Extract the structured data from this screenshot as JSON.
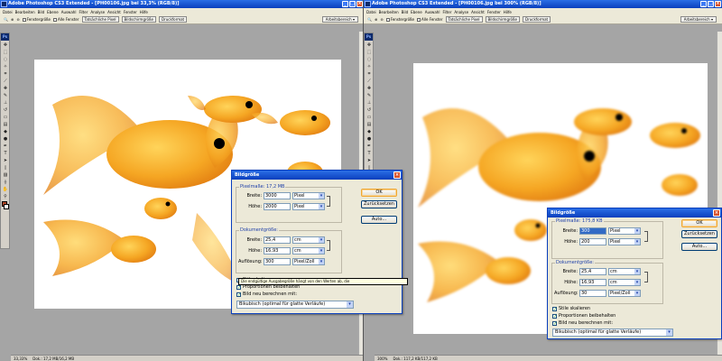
{
  "left": {
    "title": "Adobe Photoshop CS3 Extended - [PH00106.jpg bei 33,3% (RGB/8)]",
    "status_zoom": "33,33%",
    "status_doc": "Dok.: 17,2 MB/16,2 MB"
  },
  "right": {
    "title": "Adobe Photoshop CS3 Extended - [PH00106.jpg bei 300% (RGB/8)]",
    "status_zoom": "300%",
    "status_doc": "Dok.: 117,2 KB/117,2 KB"
  },
  "menu": [
    "Datei",
    "Bearbeiten",
    "Bild",
    "Ebene",
    "Auswahl",
    "Filter",
    "Analyse",
    "Ansicht",
    "Fenster",
    "Hilfe"
  ],
  "options": {
    "resize_windows": "Fenstergröße",
    "all_windows": "Alle Fenster",
    "actual_pixels": "Tatsächliche Pixel",
    "fit_screen": "Bildschirmgröße",
    "print_size": "Druckformat",
    "workspace": "Arbeitsbereich ▾"
  },
  "dialog": {
    "title": "Bildgröße",
    "ok": "OK",
    "reset": "Zurücksetzen",
    "auto": "Auto...",
    "doc_group": "Dokumentgröße:",
    "width_label": "Breite:",
    "height_label": "Höhe:",
    "resolution_label": "Auflösung:",
    "pixel_unit": "Pixel",
    "cm_unit": "cm",
    "res_unit": "Pixel/Zoll",
    "scale_styles": "Stile skalieren",
    "constrain": "Proportionen beibehalten",
    "resample": "Bild neu berechnen mit:",
    "method": "Bikubisch (optimal für glatte Verläufe)"
  },
  "dialogL": {
    "pixel_dims": "Pixelmaße: 17,2 MB",
    "px_width": "3000",
    "px_height": "2000",
    "doc_width": "25,4",
    "doc_height": "16,93",
    "resolution": "300"
  },
  "dialogR": {
    "pixel_dims": "Pixelmaße: 175,8 KB",
    "px_width": "300",
    "px_height": "200",
    "doc_width": "25,4",
    "doc_height": "16,93",
    "resolution": "30"
  },
  "tooltip": "Die endgültige Ausgabegröße hängt von den Werten ab, die"
}
